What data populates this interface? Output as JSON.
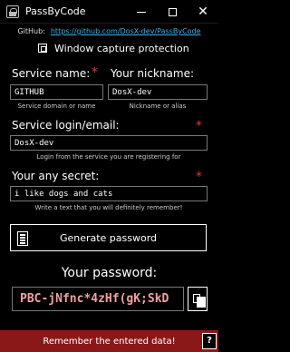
{
  "window": {
    "title": "PassByCode",
    "minimize_icon": "minimize-icon",
    "maximize_icon": "maximize-icon",
    "close_icon": "close-icon",
    "close_glyph": "✕"
  },
  "github": {
    "label": "GitHub:",
    "url": "https://github.com/DosX-dev/PassByCode"
  },
  "capture": {
    "label": "Window capture protection",
    "checked": true
  },
  "service": {
    "label": "Service name:",
    "value": "GITHUB",
    "hint": "Service domain or name"
  },
  "nickname": {
    "label": "Your nickname:",
    "value": "DosX-dev",
    "hint": "Nickname or alias"
  },
  "login": {
    "label": "Service login/email:",
    "value": "DosX-dev",
    "hint": "Login from the service you are registering for"
  },
  "secret": {
    "label": "Your any secret:",
    "value": "i like dogs and cats",
    "hint": "Write a text that you will definitely remember!"
  },
  "required_mark": "*",
  "generate": {
    "label": "Generate password",
    "icon": "notepad-icon"
  },
  "password": {
    "title": "Your password:",
    "value": "PBC-jNfnc*4zHf(gK;SkD",
    "copy_icon": "copy-icon"
  },
  "footer": {
    "text": "Remember the entered data!",
    "help_label": "?"
  },
  "colors": {
    "background": "#000000",
    "accent_link": "#3bb0e8",
    "required_star": "#e03a3a",
    "password_text": "#f3a0a0",
    "footer_bg": "#8b1818"
  }
}
